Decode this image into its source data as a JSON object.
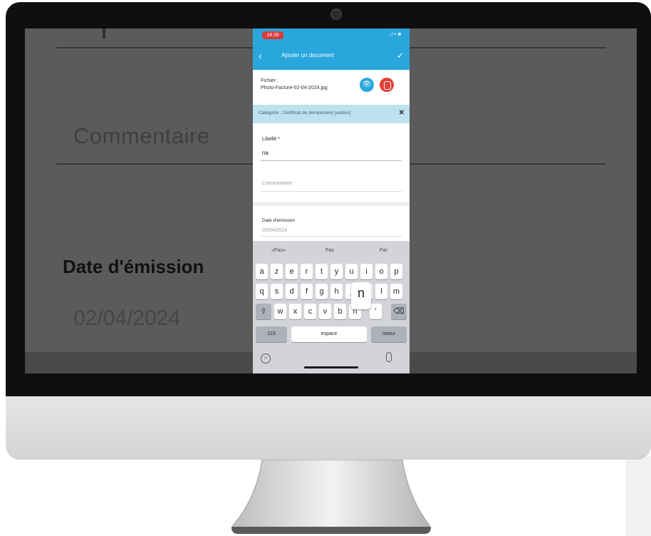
{
  "background_screen": {
    "comment_placeholder": "Commentaire",
    "date_label": "Date d'émission",
    "date_value": "02/04/2024"
  },
  "phone": {
    "status": {
      "time": "14:35",
      "icons": "..l ≈ ■"
    },
    "header": {
      "title": "Ajouter un document",
      "back_icon": "chevron-left",
      "confirm_icon": "check"
    },
    "file": {
      "label": "Fichier :",
      "name": "Photo-Facture-02-04-2024.jpg"
    },
    "category": {
      "text": "Catégorie : Certificat de (temporaire) [autres]",
      "close_icon": "close"
    },
    "name_field": {
      "label": "Libellé *",
      "value": "na"
    },
    "comment_field": {
      "placeholder": "Commentaire"
    },
    "date_field": {
      "label": "Date d'émission",
      "placeholder": "02/04/2024"
    },
    "keyboard": {
      "suggestions": [
        "«Pas»",
        "Pas",
        "Par"
      ],
      "row1": [
        "a",
        "z",
        "e",
        "r",
        "t",
        "y",
        "u",
        "i",
        "o",
        "p"
      ],
      "row2": [
        "q",
        "s",
        "d",
        "f",
        "g",
        "h",
        "j",
        "k",
        "l",
        "m"
      ],
      "row3": [
        "w",
        "x",
        "c",
        "v",
        "b",
        "n",
        "'"
      ],
      "shift_label": "⇧",
      "delete_label": "⌫",
      "numbers_label": "123",
      "space_label": "espace",
      "return_label": "retour",
      "popup_key": "n"
    }
  },
  "colors": {
    "accent": "#29a7dd",
    "delete": "#e0403a",
    "category_bg": "#bde1ee"
  }
}
